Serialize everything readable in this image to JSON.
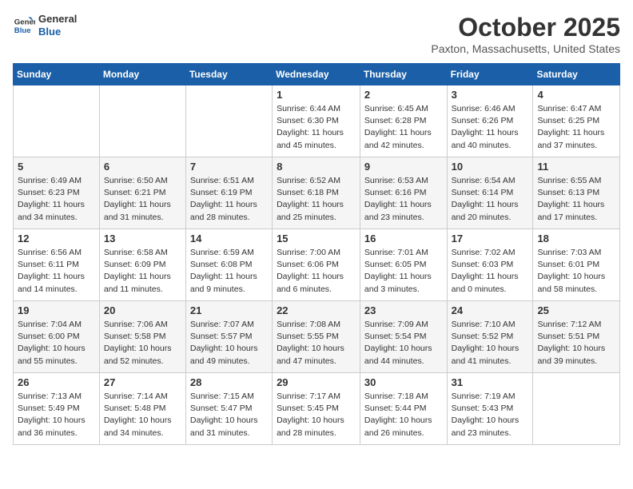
{
  "header": {
    "logo_line1": "General",
    "logo_line2": "Blue",
    "month": "October 2025",
    "location": "Paxton, Massachusetts, United States"
  },
  "weekdays": [
    "Sunday",
    "Monday",
    "Tuesday",
    "Wednesday",
    "Thursday",
    "Friday",
    "Saturday"
  ],
  "weeks": [
    [
      {
        "day": "",
        "info": ""
      },
      {
        "day": "",
        "info": ""
      },
      {
        "day": "",
        "info": ""
      },
      {
        "day": "1",
        "info": "Sunrise: 6:44 AM\nSunset: 6:30 PM\nDaylight: 11 hours\nand 45 minutes."
      },
      {
        "day": "2",
        "info": "Sunrise: 6:45 AM\nSunset: 6:28 PM\nDaylight: 11 hours\nand 42 minutes."
      },
      {
        "day": "3",
        "info": "Sunrise: 6:46 AM\nSunset: 6:26 PM\nDaylight: 11 hours\nand 40 minutes."
      },
      {
        "day": "4",
        "info": "Sunrise: 6:47 AM\nSunset: 6:25 PM\nDaylight: 11 hours\nand 37 minutes."
      }
    ],
    [
      {
        "day": "5",
        "info": "Sunrise: 6:49 AM\nSunset: 6:23 PM\nDaylight: 11 hours\nand 34 minutes."
      },
      {
        "day": "6",
        "info": "Sunrise: 6:50 AM\nSunset: 6:21 PM\nDaylight: 11 hours\nand 31 minutes."
      },
      {
        "day": "7",
        "info": "Sunrise: 6:51 AM\nSunset: 6:19 PM\nDaylight: 11 hours\nand 28 minutes."
      },
      {
        "day": "8",
        "info": "Sunrise: 6:52 AM\nSunset: 6:18 PM\nDaylight: 11 hours\nand 25 minutes."
      },
      {
        "day": "9",
        "info": "Sunrise: 6:53 AM\nSunset: 6:16 PM\nDaylight: 11 hours\nand 23 minutes."
      },
      {
        "day": "10",
        "info": "Sunrise: 6:54 AM\nSunset: 6:14 PM\nDaylight: 11 hours\nand 20 minutes."
      },
      {
        "day": "11",
        "info": "Sunrise: 6:55 AM\nSunset: 6:13 PM\nDaylight: 11 hours\nand 17 minutes."
      }
    ],
    [
      {
        "day": "12",
        "info": "Sunrise: 6:56 AM\nSunset: 6:11 PM\nDaylight: 11 hours\nand 14 minutes."
      },
      {
        "day": "13",
        "info": "Sunrise: 6:58 AM\nSunset: 6:09 PM\nDaylight: 11 hours\nand 11 minutes."
      },
      {
        "day": "14",
        "info": "Sunrise: 6:59 AM\nSunset: 6:08 PM\nDaylight: 11 hours\nand 9 minutes."
      },
      {
        "day": "15",
        "info": "Sunrise: 7:00 AM\nSunset: 6:06 PM\nDaylight: 11 hours\nand 6 minutes."
      },
      {
        "day": "16",
        "info": "Sunrise: 7:01 AM\nSunset: 6:05 PM\nDaylight: 11 hours\nand 3 minutes."
      },
      {
        "day": "17",
        "info": "Sunrise: 7:02 AM\nSunset: 6:03 PM\nDaylight: 11 hours\nand 0 minutes."
      },
      {
        "day": "18",
        "info": "Sunrise: 7:03 AM\nSunset: 6:01 PM\nDaylight: 10 hours\nand 58 minutes."
      }
    ],
    [
      {
        "day": "19",
        "info": "Sunrise: 7:04 AM\nSunset: 6:00 PM\nDaylight: 10 hours\nand 55 minutes."
      },
      {
        "day": "20",
        "info": "Sunrise: 7:06 AM\nSunset: 5:58 PM\nDaylight: 10 hours\nand 52 minutes."
      },
      {
        "day": "21",
        "info": "Sunrise: 7:07 AM\nSunset: 5:57 PM\nDaylight: 10 hours\nand 49 minutes."
      },
      {
        "day": "22",
        "info": "Sunrise: 7:08 AM\nSunset: 5:55 PM\nDaylight: 10 hours\nand 47 minutes."
      },
      {
        "day": "23",
        "info": "Sunrise: 7:09 AM\nSunset: 5:54 PM\nDaylight: 10 hours\nand 44 minutes."
      },
      {
        "day": "24",
        "info": "Sunrise: 7:10 AM\nSunset: 5:52 PM\nDaylight: 10 hours\nand 41 minutes."
      },
      {
        "day": "25",
        "info": "Sunrise: 7:12 AM\nSunset: 5:51 PM\nDaylight: 10 hours\nand 39 minutes."
      }
    ],
    [
      {
        "day": "26",
        "info": "Sunrise: 7:13 AM\nSunset: 5:49 PM\nDaylight: 10 hours\nand 36 minutes."
      },
      {
        "day": "27",
        "info": "Sunrise: 7:14 AM\nSunset: 5:48 PM\nDaylight: 10 hours\nand 34 minutes."
      },
      {
        "day": "28",
        "info": "Sunrise: 7:15 AM\nSunset: 5:47 PM\nDaylight: 10 hours\nand 31 minutes."
      },
      {
        "day": "29",
        "info": "Sunrise: 7:17 AM\nSunset: 5:45 PM\nDaylight: 10 hours\nand 28 minutes."
      },
      {
        "day": "30",
        "info": "Sunrise: 7:18 AM\nSunset: 5:44 PM\nDaylight: 10 hours\nand 26 minutes."
      },
      {
        "day": "31",
        "info": "Sunrise: 7:19 AM\nSunset: 5:43 PM\nDaylight: 10 hours\nand 23 minutes."
      },
      {
        "day": "",
        "info": ""
      }
    ]
  ]
}
